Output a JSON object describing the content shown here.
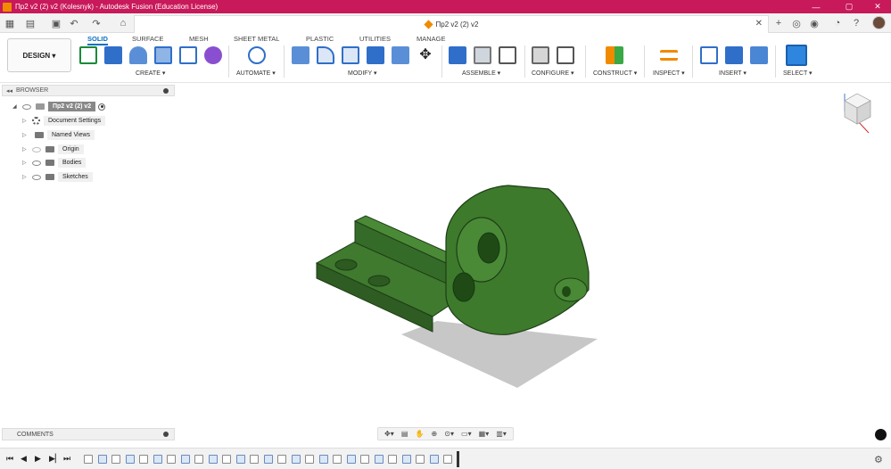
{
  "window": {
    "title": "Пр2 v2 (2) v2 (Kolesnyk) - Autodesk Fusion (Education License)",
    "controls": [
      "—",
      "▢",
      "✕"
    ]
  },
  "document_tab": {
    "label": "Пр2 v2 (2) v2",
    "close": "✕"
  },
  "design_button": {
    "label": "DESIGN ▾"
  },
  "workspace_tabs": [
    "SOLID",
    "SURFACE",
    "MESH",
    "SHEET METAL",
    "PLASTIC",
    "UTILITIES",
    "MANAGE"
  ],
  "active_tab": "SOLID",
  "tool_groups": [
    {
      "label": "CREATE ▾"
    },
    {
      "label": "AUTOMATE ▾"
    },
    {
      "label": "MODIFY ▾"
    },
    {
      "label": "ASSEMBLE ▾"
    },
    {
      "label": "CONFIGURE ▾"
    },
    {
      "label": "CONSTRUCT ▾"
    },
    {
      "label": "INSPECT ▾"
    },
    {
      "label": "INSERT ▾"
    },
    {
      "label": "SELECT ▾"
    }
  ],
  "browser": {
    "title": "BROWSER",
    "root": "Пр2 v2 (2) v2",
    "items": [
      "Document Settings",
      "Named Views",
      "Origin",
      "Bodies",
      "Sketches"
    ]
  },
  "comments": {
    "title": "COMMENTS"
  },
  "colors": {
    "titlebar": "#c8195a",
    "accent": "#0a6fc2",
    "model": "#3f7a2f"
  },
  "icons": [
    "grid-icon",
    "file-icon",
    "save-icon",
    "undo-icon",
    "redo-icon",
    "home-icon",
    "plus-icon",
    "extensions-icon",
    "job-status-icon",
    "notifications-icon",
    "help-icon"
  ]
}
